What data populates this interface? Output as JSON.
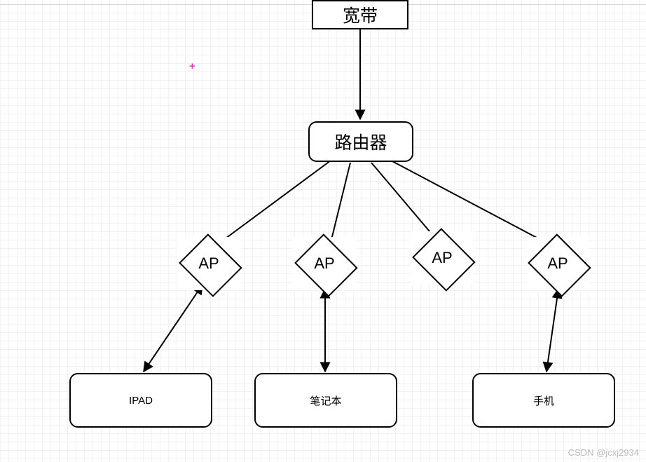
{
  "nodes": {
    "broadband": "宽带",
    "router": "路由器",
    "ap1": "AP",
    "ap2": "AP",
    "ap3": "AP",
    "ap4": "AP",
    "ipad": "IPAD",
    "laptop": "笔记本",
    "phone": "手机"
  },
  "edges": [
    {
      "from": "broadband",
      "to": "router",
      "arrow": "end"
    },
    {
      "from": "router",
      "to": "ap1",
      "arrow": "end"
    },
    {
      "from": "router",
      "to": "ap2",
      "arrow": "end"
    },
    {
      "from": "router",
      "to": "ap3",
      "arrow": "end"
    },
    {
      "from": "router",
      "to": "ap4",
      "arrow": "end"
    },
    {
      "from": "ap1",
      "to": "ipad",
      "arrow": "both"
    },
    {
      "from": "ap2",
      "to": "laptop",
      "arrow": "both"
    },
    {
      "from": "ap4",
      "to": "phone",
      "arrow": "both"
    }
  ],
  "watermark": "CSDN @jcxj2934"
}
